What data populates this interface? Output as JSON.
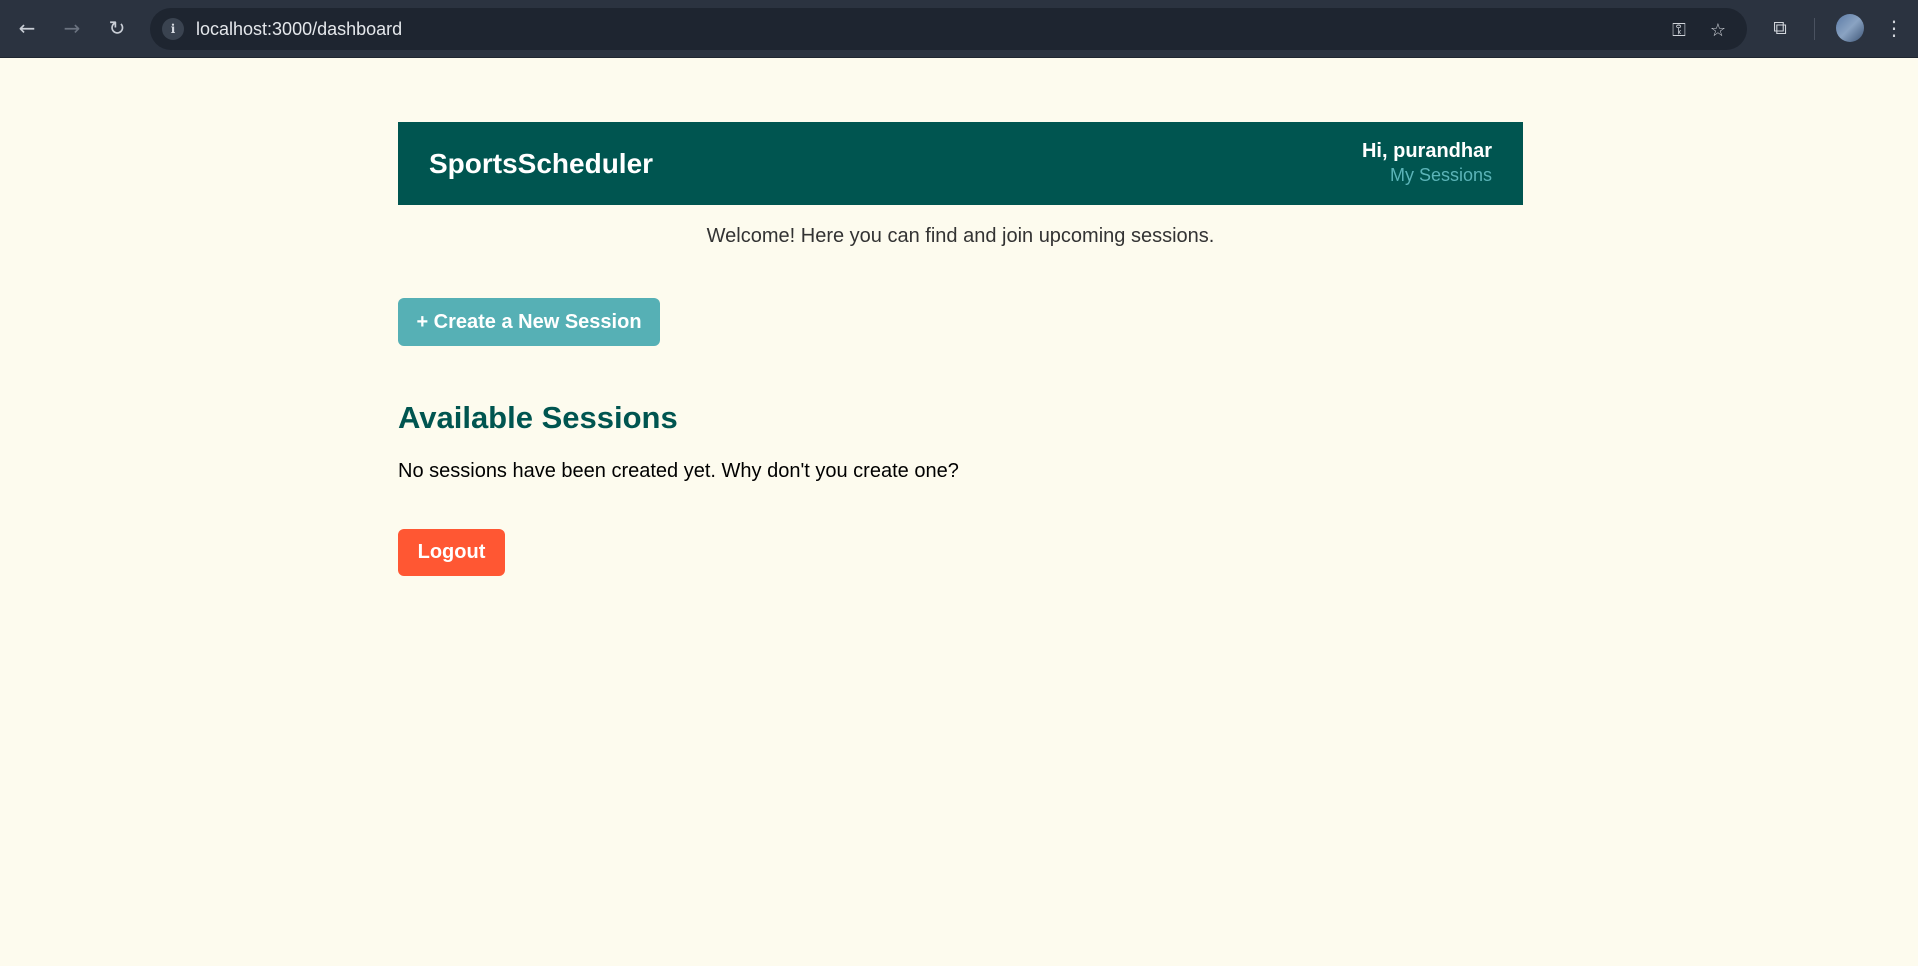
{
  "browser": {
    "url": "localhost:3000/dashboard",
    "icons": [
      "back-icon",
      "forward-icon",
      "reload-icon",
      "info-icon",
      "password-key-icon",
      "bookmark-star-icon",
      "extensions-icon",
      "profile-avatar",
      "menu-icon"
    ]
  },
  "header": {
    "brand": "SportsScheduler",
    "greeting": "Hi, purandhar",
    "my_sessions_link": "My Sessions"
  },
  "main": {
    "welcome": "Welcome! Here you can find and join upcoming sessions.",
    "create_button": "+ Create a New Session",
    "section_title": "Available Sessions",
    "empty_message": "No sessions have been created yet. Why don't you create one?",
    "logout_button": "Logout"
  },
  "colors": {
    "background": "#fdfbee",
    "header": "#005550",
    "accent": "#56b0b5",
    "logout": "#ff5733"
  }
}
